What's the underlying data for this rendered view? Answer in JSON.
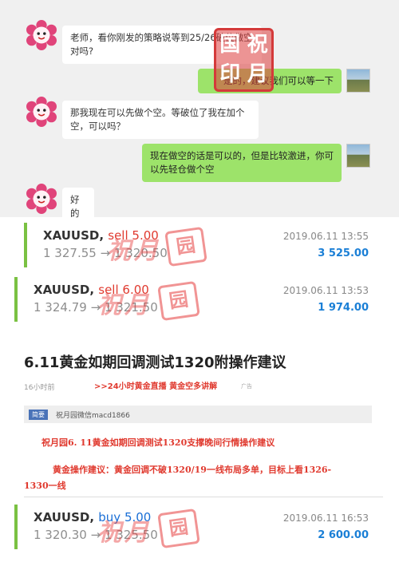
{
  "chat": {
    "messages": [
      {
        "side": "left",
        "text": "老师，看你刚发的策略说等到25/26破位做空对吗?"
      },
      {
        "side": "right",
        "text": "是的，建议我们可以等一下"
      },
      {
        "side": "left",
        "text": "那我现在可以先做个空。等破位了我在加个空，可以吗？"
      },
      {
        "side": "right",
        "text": "现在做空的话是可以的，但是比较激进，你可以先轻仓做个空"
      },
      {
        "side": "left",
        "text": "好的"
      }
    ],
    "seal_chars": [
      "国",
      "祝",
      "印",
      "月"
    ]
  },
  "trades": [
    {
      "symbol": "XAUUSD,",
      "action": "sell 5.00",
      "action_color": "#e03a2f",
      "from": "1 327.55",
      "arrow": "→",
      "to": "1 320.50",
      "datetime": "2019.06.11 13:55",
      "amount": "3 525.00"
    },
    {
      "symbol": "XAUUSD,",
      "action": "sell 6.00",
      "action_color": "#e03a2f",
      "from": "1 324.79",
      "arrow": "→",
      "to": "1 321.50",
      "datetime": "2019.06.11 13:53",
      "amount": "1 974.00"
    },
    {
      "symbol": "XAUUSD,",
      "action": "buy 5.00",
      "action_color": "#1a6fd6",
      "from": "1 320.30",
      "arrow": "→",
      "to": "1 325.50",
      "datetime": "2019.06.11 16:53",
      "amount": "2 600.00"
    }
  ],
  "watermark": {
    "text": "祝月",
    "box_char": "园"
  },
  "article": {
    "headline": "6.11黄金如期回调测试1320附操作建议",
    "time": "16小时前",
    "live_link": ">>24小时黄金直播 黄金空多讲解",
    "ad_tag": "广告",
    "wx_badge": "简要",
    "wx_text": "祝月园微信macd1866",
    "subtitle": "祝月园6. 11黄金如期回调测试1320支撑晚间行情操作建议",
    "advice_line1": "黄金操作建议：黄金回调不破1320/19一线布局多单，目标上看1326-",
    "advice_line2": "1330一线"
  }
}
